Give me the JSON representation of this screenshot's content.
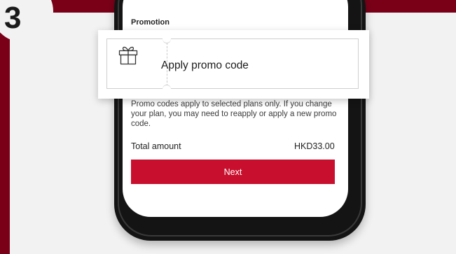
{
  "step": {
    "number": "3"
  },
  "checkout": {
    "section_title": "Promotion",
    "promo_button_label": "Apply promo code",
    "promo_icon": "gift-icon",
    "notice": "Promo codes apply to selected plans only. If you change your plan, you may need to reapply or apply a new promo code.",
    "total_label": "Total amount",
    "total_value": "HKD33.00",
    "next_label": "Next"
  },
  "colors": {
    "brand_dark": "#7a0018",
    "accent_red": "#c8102e",
    "background": "#f2f2f2"
  }
}
